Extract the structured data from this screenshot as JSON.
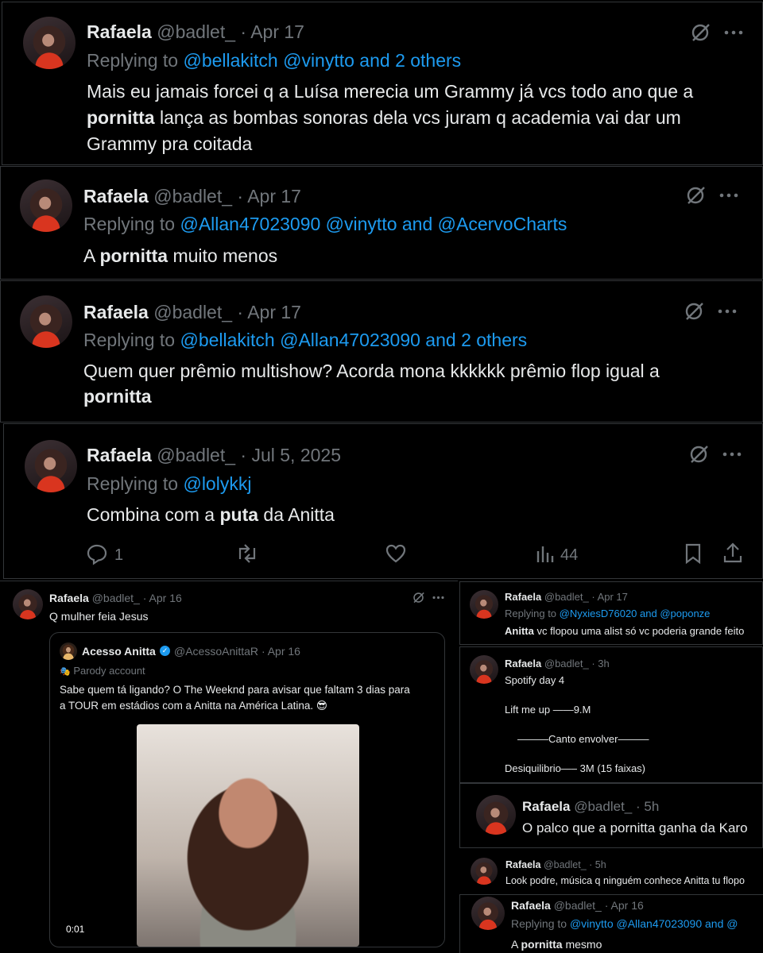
{
  "tweets": [
    {
      "name": "Rafaela",
      "handle": "@badlet_",
      "date": "· Apr 17",
      "replying_prefix": "Replying to",
      "replying_to": "@bellakitch @vinytto and 2 others",
      "text_lines": [
        {
          "pre": "Mais eu jamais forcei q a Luísa merecia um Grammy já vcs todo ano que a",
          "bold": "",
          "post": ""
        },
        {
          "pre": "",
          "bold": "pornitta",
          "post": " lança as bombas sonoras dela vcs  juram q academia vai dar um"
        },
        {
          "pre": "Grammy pra coitada",
          "bold": "",
          "post": ""
        }
      ]
    },
    {
      "name": "Rafaela",
      "handle": "@badlet_",
      "date": "· Apr 17",
      "replying_prefix": "Replying to",
      "replying_to": "@Allan47023090 @vinytto and @AcervoCharts",
      "text_lines": [
        {
          "pre": "A ",
          "bold": "pornitta",
          "post": " muito menos"
        }
      ]
    },
    {
      "name": "Rafaela",
      "handle": "@badlet_",
      "date": "· Apr 17",
      "replying_prefix": "Replying to",
      "replying_to": "@bellakitch @Allan47023090 and 2 others",
      "text_lines": [
        {
          "pre": "Quem quer prêmio multishow? Acorda mona kkkkkk prêmio flop igual a",
          "bold": "",
          "post": ""
        },
        {
          "pre": "",
          "bold": "pornitta",
          "post": ""
        }
      ]
    },
    {
      "name": "Rafaela",
      "handle": "@badlet_",
      "date": "· Jul 5, 2025",
      "replying_prefix": "Replying to",
      "replying_to": "@lolykkj",
      "text_lines": [
        {
          "pre": "Combina com a ",
          "bold": "puta",
          "post": " da Anitta"
        }
      ],
      "actions": {
        "replies": "1",
        "views": "44"
      }
    }
  ],
  "quote_tweet": {
    "name": "Rafaela",
    "handle": "@badlet_",
    "date": "· Apr 16",
    "text": "Q mulher feia Jesus",
    "quoted": {
      "name": "Acesso Anitta",
      "verified_mark": "✓",
      "handle": "@AcessoAnittaR",
      "date": "· Apr 16",
      "parody_icon": "🎭",
      "parody_label": "Parody account",
      "text_line1": "Sabe quem tá ligando? O The Weeknd para avisar que faltam 3 dias para",
      "text_line2": "a TOUR em estádios com a Anitta na América Latina. 😎",
      "video_time": "0:01"
    }
  },
  "side_tweets": [
    {
      "name": "Rafaela",
      "handle": "@badlet_",
      "date": "· Apr 17",
      "replying_prefix": "Replying to",
      "replying_to": "@NyxiesD76020 and @poponze",
      "text_bold": "Anitta",
      "text_rest": " vc flopou uma alist só vc poderia grande feito"
    },
    {
      "name": "Rafaela",
      "handle": "@badlet_",
      "date": "· 3h",
      "lines": [
        "Spotify day 4",
        "Lift me up ——9.M",
        "———Canto envolver———",
        "Desiquilibrio—– 3M (15 faixas)"
      ]
    },
    {
      "name": "Rafaela",
      "handle": "@badlet_",
      "date": "· 5h",
      "text": "O palco que a pornitta ganha da Karo"
    },
    {
      "name": "Rafaela",
      "handle": "@badlet_",
      "date": "· 5h",
      "text": "Look podre, música q ninguém conhece Anitta tu flopo"
    },
    {
      "name": "Rafaela",
      "handle": "@badlet_",
      "date": "· Apr 16",
      "replying_prefix": "Replying to",
      "replying_to": "@vinytto @Allan47023090 and @",
      "text_pre": "A ",
      "text_bold": "pornitta",
      "text_post": " mesmo"
    }
  ]
}
